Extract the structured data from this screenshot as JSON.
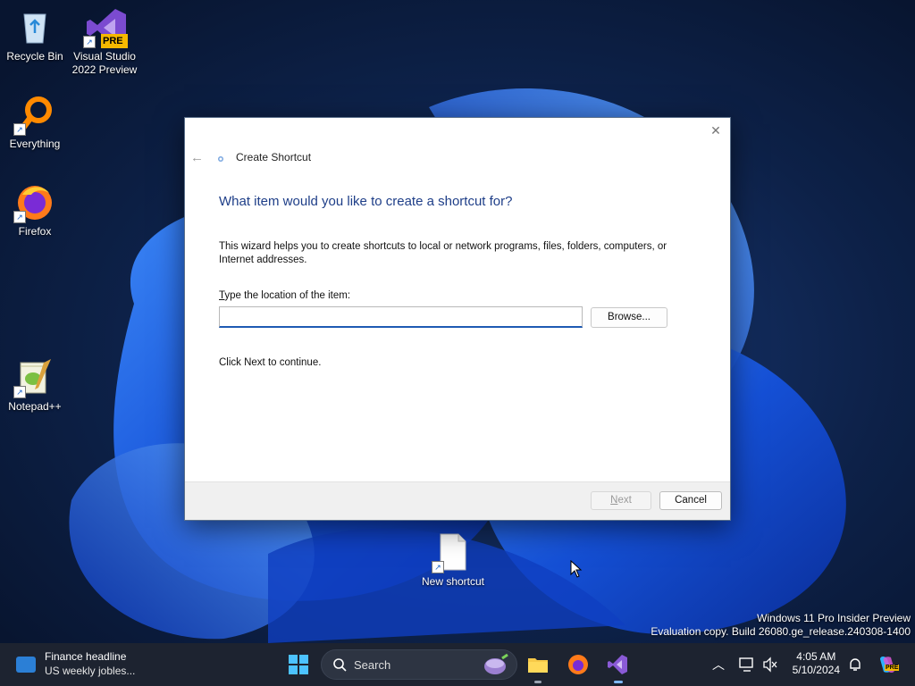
{
  "desktop": {
    "icons": [
      {
        "label": "Recycle Bin"
      },
      {
        "label": "Visual Studio\n2022 Preview",
        "badge": "PRE"
      },
      {
        "label": "Everything"
      },
      {
        "label": "Firefox"
      },
      {
        "label": "Notepad++"
      },
      {
        "label": "New shortcut"
      }
    ]
  },
  "dialog": {
    "title": "Create Shortcut",
    "heading": "What item would you like to create a shortcut for?",
    "description": "This wizard helps you to create shortcuts to local or network programs, files, folders, computers, or Internet addresses.",
    "location_label": "Type the location of the item:",
    "location_value": "",
    "browse_label": "Browse...",
    "hint": "Click Next to continue.",
    "next_label": "Next",
    "cancel_label": "Cancel"
  },
  "watermark": {
    "line1": "Windows 11 Pro Insider Preview",
    "line2": "Evaluation copy. Build 26080.ge_release.240308-1400"
  },
  "taskbar": {
    "news_headline": "Finance headline",
    "news_sub": "US weekly jobles...",
    "search_label": "Search",
    "copilot_badge": "PRE",
    "time": "4:05 AM",
    "date": "5/10/2024"
  },
  "colors": {
    "accent": "#1e5ab3",
    "heading": "#1e3e88",
    "taskbar": "#1d2330"
  }
}
